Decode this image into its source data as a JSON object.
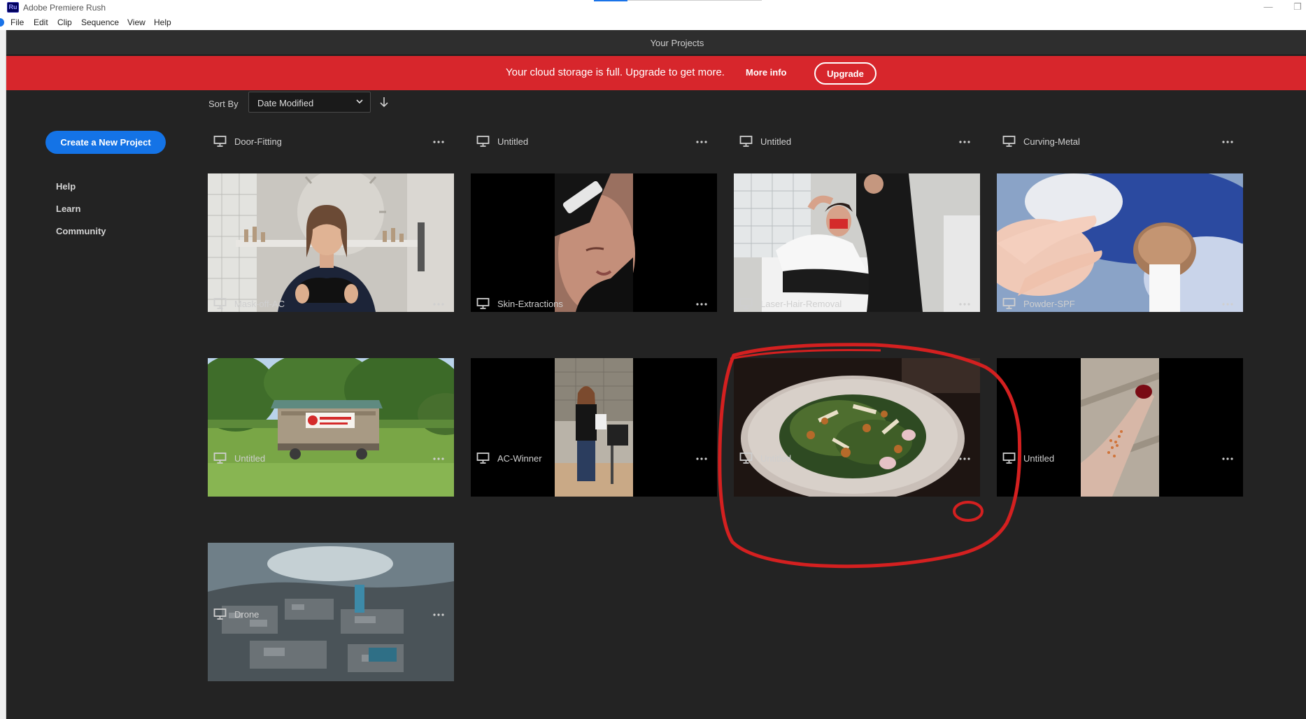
{
  "window": {
    "title": "Adobe Premiere Rush",
    "badge": "Ru"
  },
  "menu": [
    "File",
    "Edit",
    "Clip",
    "Sequence",
    "View",
    "Help"
  ],
  "header": {
    "title": "Your Projects"
  },
  "banner": {
    "message": "Your cloud storage is full. Upgrade to get more.",
    "more_info": "More info",
    "upgrade": "Upgrade",
    "color": "#d7262c"
  },
  "sort": {
    "label": "Sort By",
    "value": "Date Modified",
    "direction_icon": "arrow-down-icon"
  },
  "sidebar": {
    "create_label": "Create a New Project",
    "links": [
      "Help",
      "Learn",
      "Community"
    ],
    "accent": "#1473e6"
  },
  "projects": [
    {
      "title": "Door-Fitting",
      "thumbnail": "none"
    },
    {
      "title": "Untitled",
      "thumbnail": "none"
    },
    {
      "title": "Untitled",
      "thumbnail": "none"
    },
    {
      "title": "Curving-Metal",
      "thumbnail": "none"
    },
    {
      "title": "Mask-off-AC",
      "thumbnail": "woman-holding-mask"
    },
    {
      "title": "Skin-Extractions",
      "thumbnail": "gloved-hands-face"
    },
    {
      "title": "Laser-Hair-Removal",
      "thumbnail": "treatment-room"
    },
    {
      "title": "Powder-SPF",
      "thumbnail": "makeup-brush"
    },
    {
      "title": "Untitled",
      "thumbnail": "strawberry-farm-stand"
    },
    {
      "title": "AC-Winner",
      "thumbnail": "woman-with-award"
    },
    {
      "title": "Untitled",
      "thumbnail": "salad-plate"
    },
    {
      "title": "Untitled",
      "thumbnail": "glitter-arm"
    },
    {
      "title": "Drone",
      "thumbnail": "aerial-city"
    }
  ],
  "annotation": {
    "color": "#d42020",
    "target": "more-options on salad project"
  }
}
